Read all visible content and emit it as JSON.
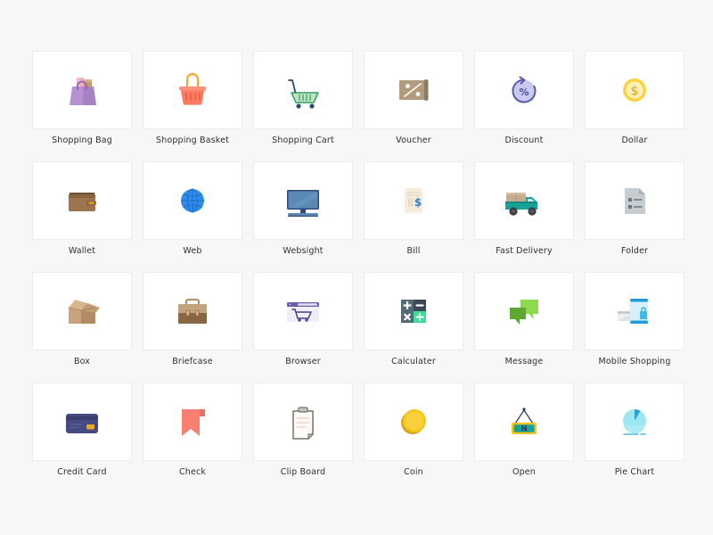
{
  "page": {
    "background_color": "#f7f7f7",
    "card_color": "#ffffff",
    "card_border_color": "#ededed",
    "label_color": "#2f2f33",
    "columns": 6,
    "rows": 4,
    "total_icons": 24
  },
  "icons": [
    {
      "label": "Shopping Bag",
      "icon_name": "shopping-bag-icon",
      "colors": {
        "primary": "#a783c4",
        "secondary": "#b692d1",
        "accent": "#f2a7c3",
        "accent2": "#c59a6a"
      }
    },
    {
      "label": "Shopping Basket",
      "icon_name": "shopping-basket-icon",
      "colors": {
        "primary": "#fa7a62",
        "secondary": "#ff9478",
        "accent": "#f9a826"
      }
    },
    {
      "label": "Shopping Cart",
      "icon_name": "shopping-cart-icon",
      "colors": {
        "primary": "#bfe3c4",
        "secondary": "#2b4a7a",
        "accent": "#2e9e5b"
      }
    },
    {
      "label": "Voucher",
      "icon_name": "voucher-icon",
      "colors": {
        "primary": "#b39b7e",
        "secondary": "#8d7a62",
        "accent": "#ffffff"
      }
    },
    {
      "label": "Discount",
      "icon_name": "discount-icon",
      "colors": {
        "primary": "#c9c9ee",
        "secondary": "#5b58a8",
        "accent": "#4e4b9c"
      }
    },
    {
      "label": "Dollar",
      "icon_name": "dollar-icon",
      "colors": {
        "primary": "#ffd23f",
        "secondary": "#fdf0b8",
        "accent": "#d8a21c"
      }
    },
    {
      "label": "Wallet",
      "icon_name": "wallet-icon",
      "colors": {
        "primary": "#8a6542",
        "secondary": "#9c7450",
        "accent": "#d8a21c"
      }
    },
    {
      "label": "Web",
      "icon_name": "web-globe-icon",
      "colors": {
        "primary": "#2f8eed",
        "secondary": "#1f6fc4",
        "accent": "#5aa8f2"
      }
    },
    {
      "label": "Websight",
      "icon_name": "monitor-icon",
      "colors": {
        "primary": "#5b89b5",
        "secondary": "#2b4a7a",
        "accent": "#6f9cc6"
      }
    },
    {
      "label": "Bill",
      "icon_name": "bill-receipt-icon",
      "colors": {
        "primary": "#f5ecdc",
        "secondary": "#e3d6c0",
        "accent": "#2f80c9"
      }
    },
    {
      "label": "Fast Delivery",
      "icon_name": "delivery-truck-icon",
      "colors": {
        "primary": "#17a398",
        "secondary": "#c4ac8e",
        "accent": "#3d3d47"
      }
    },
    {
      "label": "Folder",
      "icon_name": "document-folder-icon",
      "colors": {
        "primary": "#c7ccd1",
        "secondary": "#aab1b8",
        "accent": "#6e767e"
      }
    },
    {
      "label": "Box",
      "icon_name": "box-icon",
      "colors": {
        "primary": "#b5norm",
        "secondary": "#9c7450",
        "accent": "#c9a37b"
      }
    },
    {
      "label": "Briefcase",
      "icon_name": "briefcase-icon",
      "colors": {
        "primary": "#8a6542",
        "secondary": "#c2a37c",
        "accent": "#6e5033"
      }
    },
    {
      "label": "Browser",
      "icon_name": "browser-cart-icon",
      "colors": {
        "primary": "#f0eef7",
        "secondary": "#6b5ba8",
        "accent": "#4a3f8c"
      }
    },
    {
      "label": "Calculater",
      "icon_name": "calculator-icon",
      "colors": {
        "primary": "#546a75",
        "secondary": "#3b4a54",
        "accent": "#3ddc97"
      }
    },
    {
      "label": "Message",
      "icon_name": "message-bubble-icon",
      "colors": {
        "primary": "#7ac943",
        "secondary": "#5fa830",
        "accent": "#8fd94f"
      }
    },
    {
      "label": "Mobile Shopping",
      "icon_name": "mobile-shopping-icon",
      "colors": {
        "primary": "#d6f0fb",
        "secondary": "#1f9de0",
        "accent": "#c9ccd1"
      }
    },
    {
      "label": "Credit Card",
      "icon_name": "credit-card-icon",
      "colors": {
        "primary": "#454a80",
        "secondary": "#3a3e6e",
        "accent": "#f2a71b"
      }
    },
    {
      "label": "Check",
      "icon_name": "bookmark-check-icon",
      "colors": {
        "primary": "#f98070",
        "secondary": "#e5705f"
      }
    },
    {
      "label": "Clip Board",
      "icon_name": "clipboard-icon",
      "colors": {
        "primary": "#fdfbf8",
        "secondary": "#7a6f6a",
        "accent": "#f3c3c0"
      }
    },
    {
      "label": "Coin",
      "icon_name": "coin-icon",
      "colors": {
        "primary": "#f5c518",
        "secondary": "#d8a21c",
        "accent": "#ffd85c"
      }
    },
    {
      "label": "Open",
      "icon_name": "open-sign-icon",
      "colors": {
        "primary": "#17a398",
        "secondary": "#f5c518",
        "accent": "#2b3a6b"
      },
      "sign_text": "N"
    },
    {
      "label": "Pie Chart",
      "icon_name": "pie-chart-icon",
      "colors": {
        "primary": "#9ce8f2",
        "secondary": "#2f9ed4",
        "accent": "#5ab4e8"
      }
    }
  ]
}
